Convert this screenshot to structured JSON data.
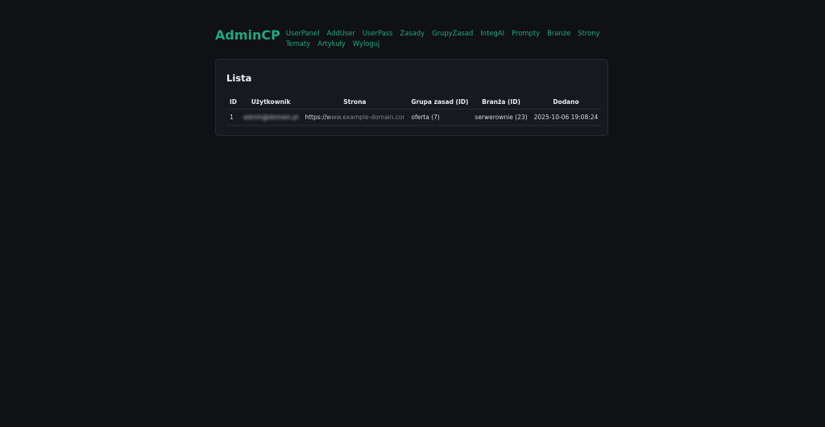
{
  "header": {
    "brand": "AdminCP",
    "nav": [
      {
        "label": "UserPanel"
      },
      {
        "label": "AddUser"
      },
      {
        "label": "UserPass"
      },
      {
        "label": "Zasady"
      },
      {
        "label": "GrupyZasad"
      },
      {
        "label": "IntegAI"
      },
      {
        "label": "Prompty"
      },
      {
        "label": "Branże"
      },
      {
        "label": "Strony"
      },
      {
        "label": "Tematy"
      },
      {
        "label": "Artykuły"
      },
      {
        "label": "Wyloguj"
      }
    ]
  },
  "list": {
    "title": "Lista",
    "columns": [
      "ID",
      "Użytkownik",
      "Strona",
      "Grupa zasad (ID)",
      "Branża (ID)",
      "Dodano"
    ],
    "rows": [
      {
        "id": "1",
        "user": "admin@domain.pl",
        "site": "https://www.example-domain.com",
        "rule_group": "oferta (7)",
        "industry": "serwerownie (23)",
        "added": "2025-10-06 19:08:24"
      }
    ]
  },
  "colors": {
    "background": "#0f1115",
    "card": "#161a20",
    "accent": "#1fa97a"
  }
}
